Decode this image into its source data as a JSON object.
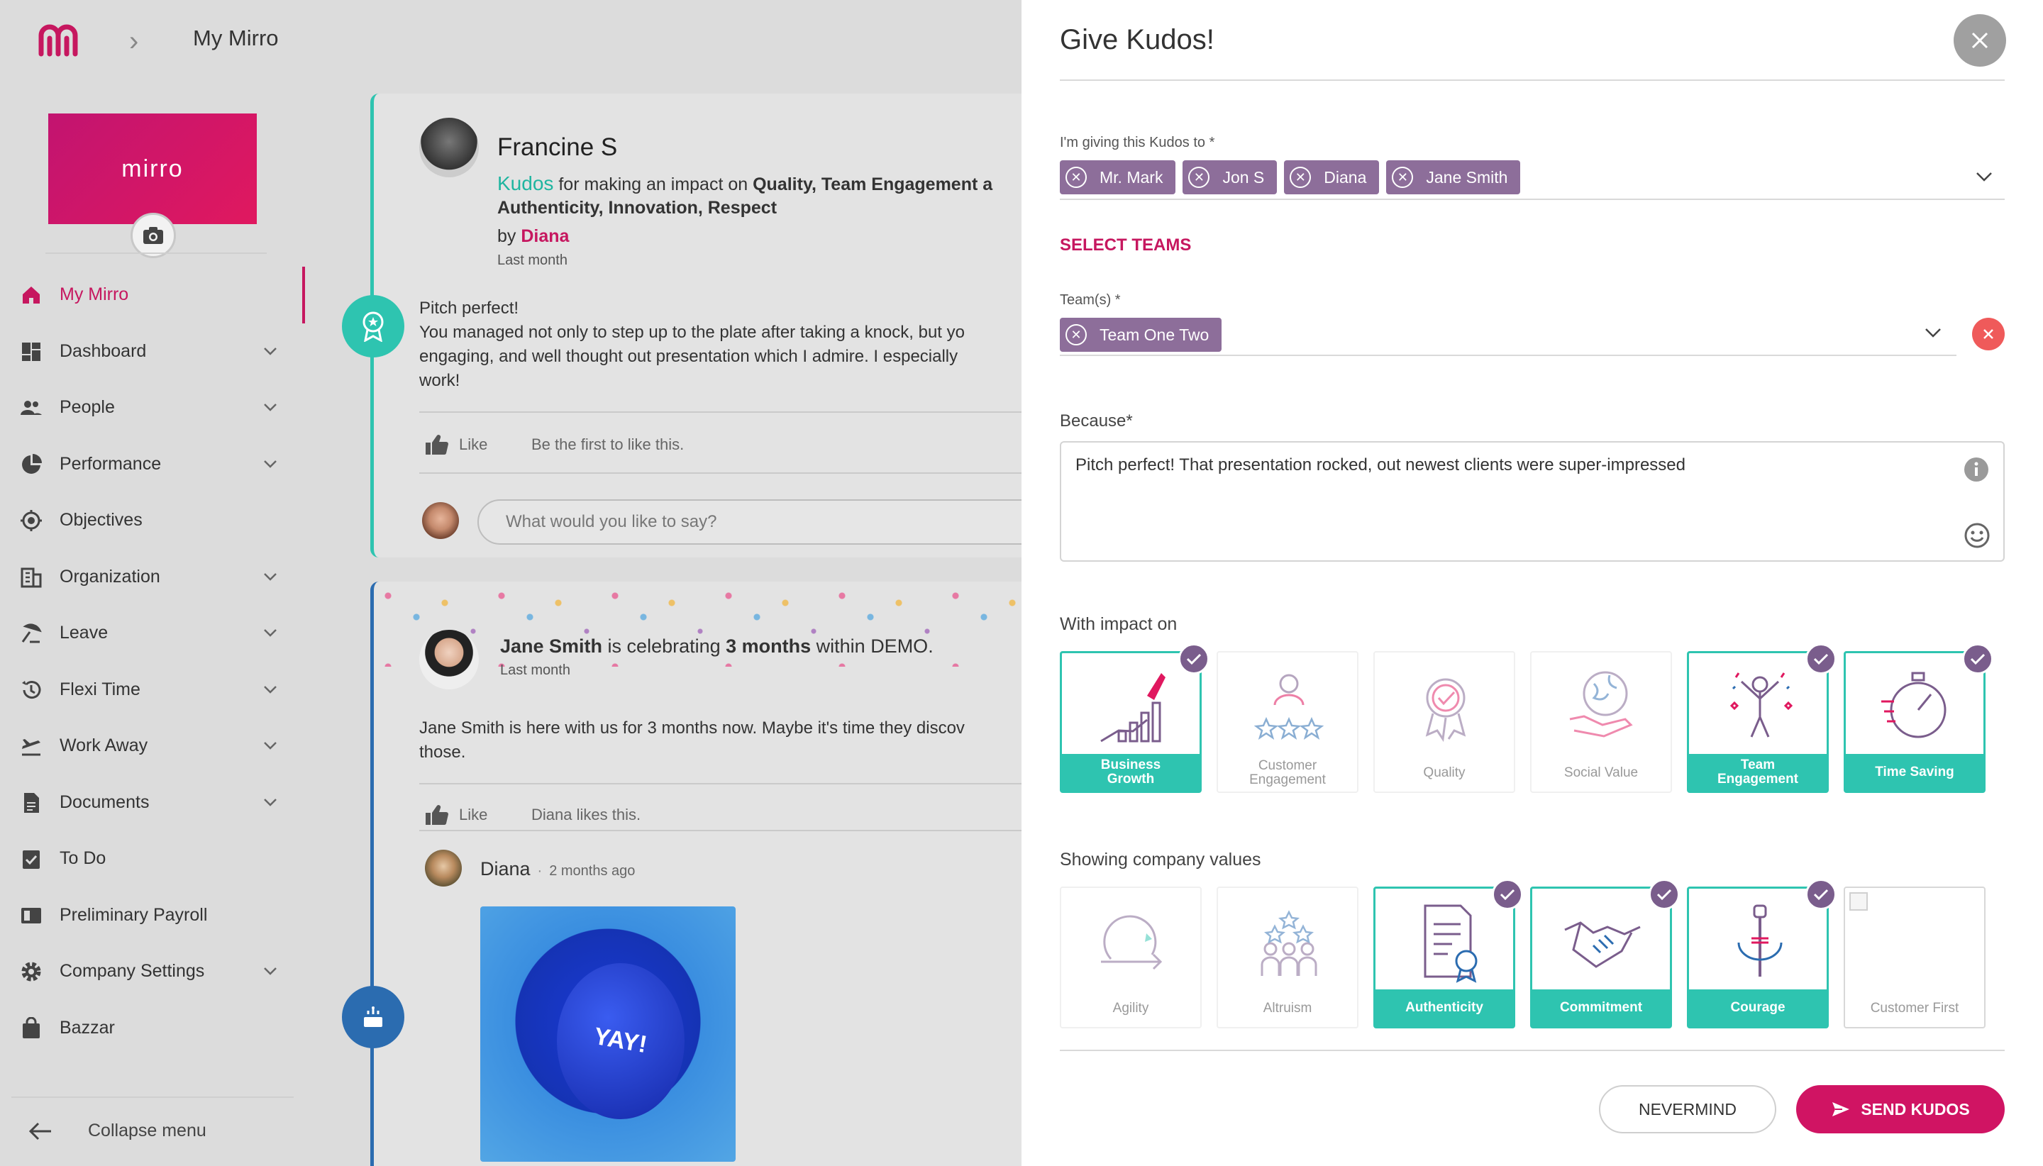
{
  "topbar": {
    "title": "My Mirro"
  },
  "brand": {
    "logo_text": "mirro"
  },
  "sidebar": {
    "items": [
      {
        "label": "My Mirro"
      },
      {
        "label": "Dashboard"
      },
      {
        "label": "People"
      },
      {
        "label": "Performance"
      },
      {
        "label": "Objectives"
      },
      {
        "label": "Organization"
      },
      {
        "label": "Leave"
      },
      {
        "label": "Flexi Time"
      },
      {
        "label": "Work Away"
      },
      {
        "label": "Documents"
      },
      {
        "label": "To Do"
      },
      {
        "label": "Preliminary Payroll"
      },
      {
        "label": "Company Settings"
      },
      {
        "label": "Bazzar"
      }
    ],
    "collapse_label": "Collapse menu"
  },
  "feed": {
    "post1": {
      "author": "Francine S",
      "kudos_word": "Kudos",
      "impact_prefix": " for making an impact on ",
      "impact_values": "Quality, Team Engagement a",
      "impact_values_line2": "Authenticity, Innovation, Respect",
      "by_prefix": "by ",
      "by_name": "Diana",
      "time": "Last month",
      "body_l1": "Pitch perfect!",
      "body_l2": "You managed not only to step up to the plate after taking a knock, but yo",
      "body_l3": "engaging, and well thought out presentation which I admire. I especially",
      "body_l4": "work!",
      "like_label": "Like",
      "like_status": "Be the first to like this.",
      "comment_placeholder": "What would you like to say?"
    },
    "post2": {
      "person": "Jane Smith",
      "celebrating": " is celebrating ",
      "duration": "3 months",
      "within": " within DEMO.",
      "time": "Last month",
      "body_l1": "Jane Smith is here with us for 3 months now. Maybe it's time they discov",
      "body_l2": "those.",
      "like_label": "Like",
      "like_status": "Diana likes this.",
      "comment_author": "Diana",
      "comment_time": "2 months ago",
      "image_text": "YAY!"
    }
  },
  "modal": {
    "title": "Give Kudos!",
    "recipients_label": "I'm giving this Kudos to *",
    "recipients": [
      "Mr. Mark",
      "Jon S",
      "Diana",
      "Jane Smith"
    ],
    "select_teams": "SELECT TEAMS",
    "teams_label": "Team(s) *",
    "teams": [
      "Team One Two"
    ],
    "because_label": "Because*",
    "because_text": "Pitch perfect! That presentation rocked, out newest clients were super-impressed",
    "impact_label": "With impact on",
    "impact_tiles": [
      {
        "l1": "Business",
        "l2": "Growth",
        "selected": true
      },
      {
        "l1": "Customer",
        "l2": "Engagement",
        "selected": false
      },
      {
        "l1": "Quality",
        "l2": "",
        "selected": false
      },
      {
        "l1": "Social Value",
        "l2": "",
        "selected": false
      },
      {
        "l1": "Team",
        "l2": "Engagement",
        "selected": true
      },
      {
        "l1": "Time Saving",
        "l2": "",
        "selected": true
      }
    ],
    "values_label": "Showing company values",
    "value_tiles": [
      {
        "l1": "Agility",
        "selected": false
      },
      {
        "l1": "Altruism",
        "selected": false
      },
      {
        "l1": "Authenticity",
        "selected": true
      },
      {
        "l1": "Commitment",
        "selected": true
      },
      {
        "l1": "Courage",
        "selected": true
      },
      {
        "l1": "Customer First",
        "selected": false
      }
    ],
    "nevermind": "NEVERMIND",
    "send": "SEND KUDOS"
  },
  "colors": {
    "brand": "#c6175f",
    "teal": "#2ec4b0",
    "chip": "#8d6e9a",
    "send": "#d01463"
  }
}
